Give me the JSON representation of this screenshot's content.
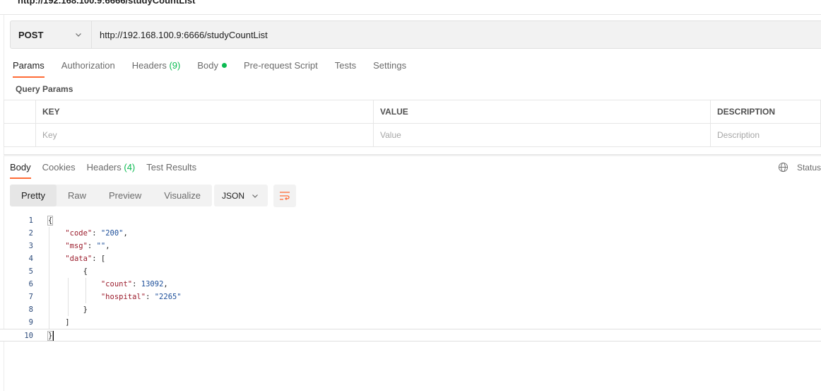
{
  "top": {
    "url_title": "http://192.168.100.9:6666/studyCountList"
  },
  "request": {
    "method": "POST",
    "url": "http://192.168.100.9:6666/studyCountList"
  },
  "request_tabs": [
    {
      "label": "Params"
    },
    {
      "label": "Authorization"
    },
    {
      "label": "Headers",
      "count": "(9)"
    },
    {
      "label": "Body"
    },
    {
      "label": "Pre-request Script"
    },
    {
      "label": "Tests"
    },
    {
      "label": "Settings"
    }
  ],
  "query_params": {
    "title": "Query Params",
    "headers": [
      "KEY",
      "VALUE",
      "DESCRIPTION"
    ],
    "placeholders": [
      "Key",
      "Value",
      "Description"
    ]
  },
  "response_tabs": [
    {
      "label": "Body"
    },
    {
      "label": "Cookies"
    },
    {
      "label": "Headers",
      "count": "(4)"
    },
    {
      "label": "Test Results"
    }
  ],
  "status_label": "Status",
  "view_modes": [
    "Pretty",
    "Raw",
    "Preview",
    "Visualize"
  ],
  "format": "JSON",
  "code": {
    "line_numbers": [
      "1",
      "2",
      "3",
      "4",
      "5",
      "6",
      "7",
      "8",
      "9",
      "10"
    ],
    "open_brace": "{",
    "close_brace": "}",
    "k_code": "\"code\"",
    "v_code": "\"200\"",
    "k_msg": "\"msg\"",
    "v_msg": "\"\"",
    "k_data": "\"data\"",
    "open_bracket": "[",
    "inner_open": "{",
    "k_count": "\"count\"",
    "v_count": "13092",
    "k_hospital": "\"hospital\"",
    "v_hospital": "\"2265\"",
    "inner_close": "}",
    "close_bracket": "]"
  },
  "colors": {
    "accent": "#ff6c37",
    "green": "#0cbb52"
  }
}
